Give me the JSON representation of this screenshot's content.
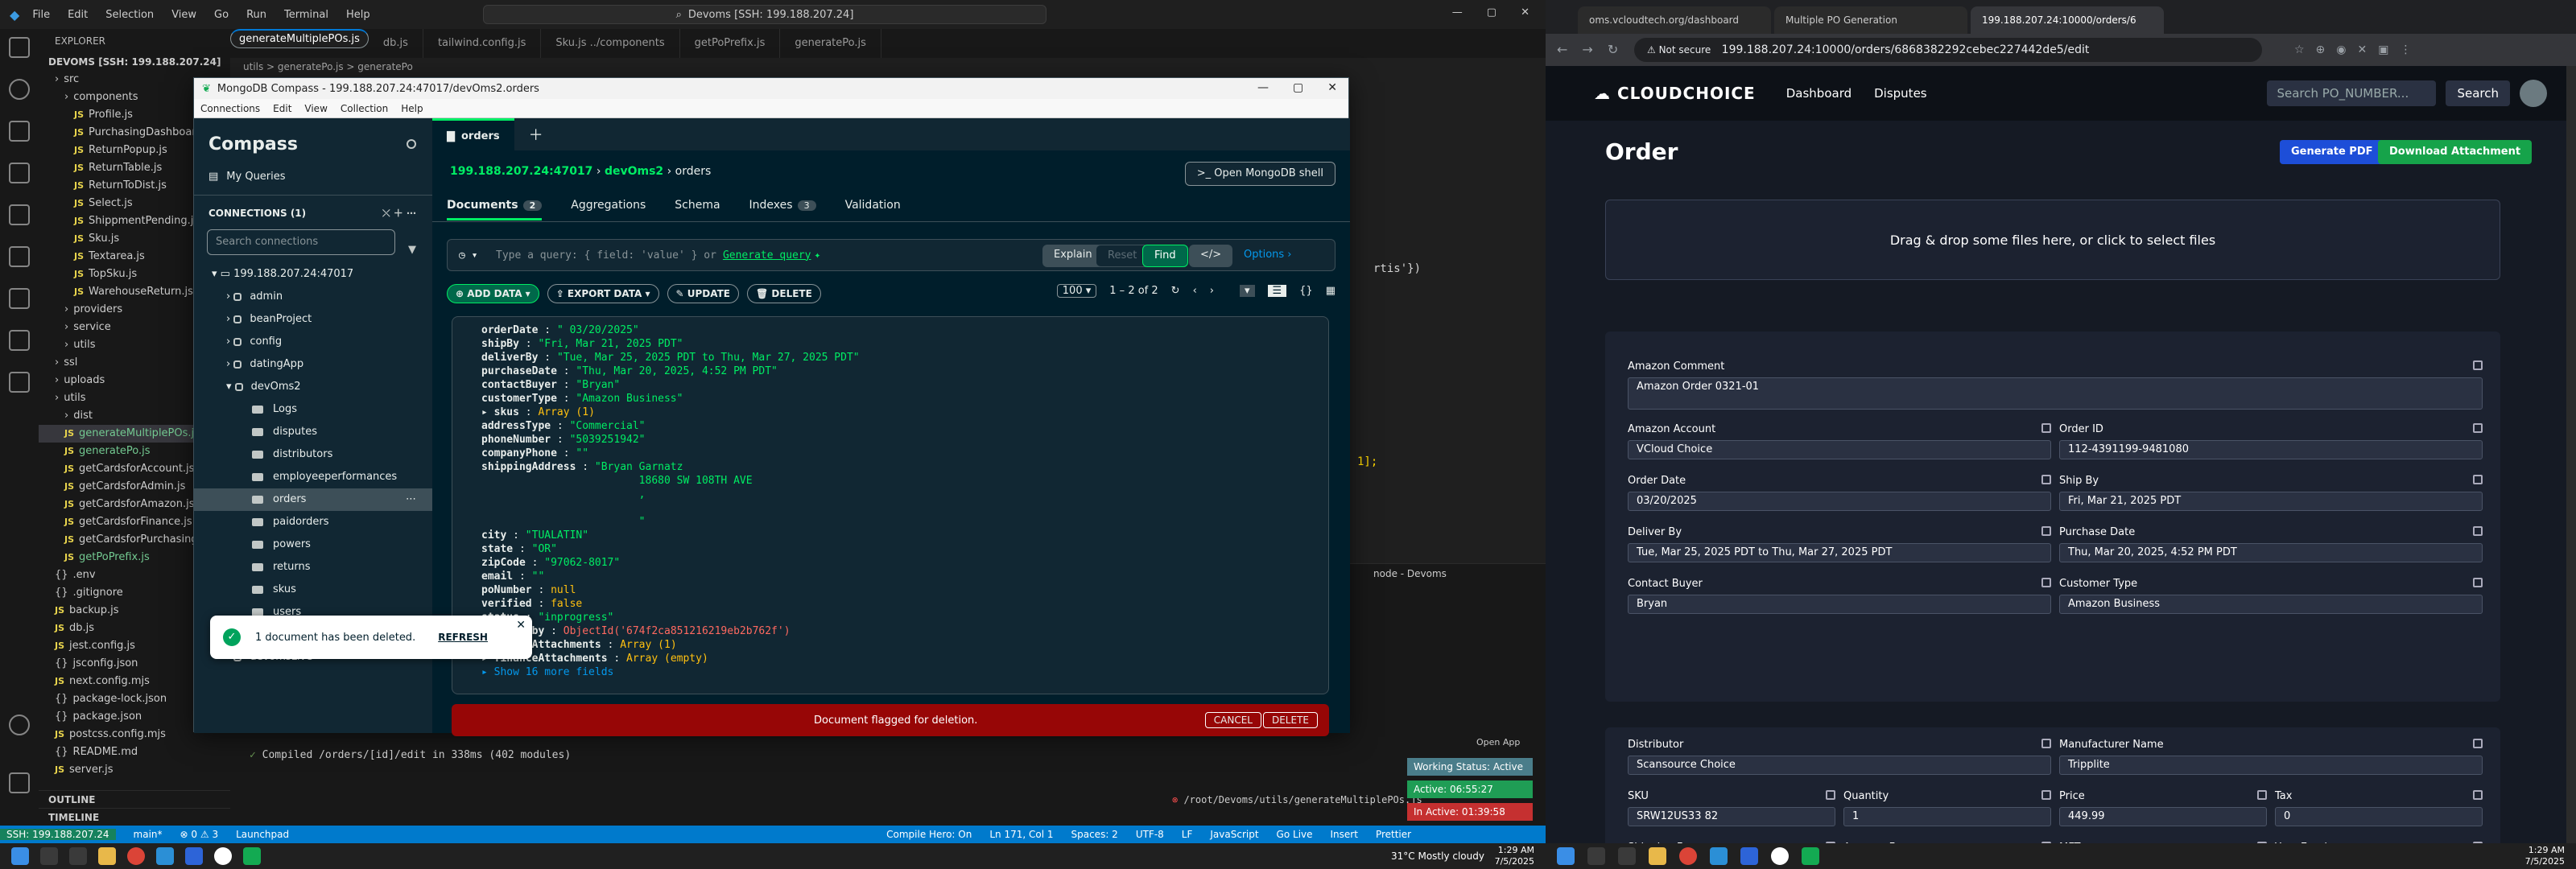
{
  "vscode": {
    "menu": [
      "File",
      "Edit",
      "Selection",
      "View",
      "Go",
      "Run",
      "Terminal",
      "Help"
    ],
    "command_center": "Devoms [SSH: 199.188.207.24]",
    "explorer_title": "EXPLORER",
    "root_label": "DEVOMS [SSH: 199.188.207.24]",
    "tree": [
      {
        "name": "src",
        "type": "folder"
      },
      {
        "name": "components",
        "type": "folder"
      },
      {
        "name": "Profile.js",
        "type": "js"
      },
      {
        "name": "PurchasingDashboard.js",
        "type": "js"
      },
      {
        "name": "ReturnPopup.js",
        "type": "js"
      },
      {
        "name": "ReturnTable.js",
        "type": "js"
      },
      {
        "name": "ReturnToDist.js",
        "type": "js"
      },
      {
        "name": "Select.js",
        "type": "js"
      },
      {
        "name": "ShippmentPending.js",
        "type": "js"
      },
      {
        "name": "Sku.js",
        "type": "js"
      },
      {
        "name": "Textarea.js",
        "type": "js"
      },
      {
        "name": "TopSku.js",
        "type": "js"
      },
      {
        "name": "WarehouseReturn.js",
        "type": "js"
      },
      {
        "name": "providers",
        "type": "folder"
      },
      {
        "name": "service",
        "type": "folder"
      },
      {
        "name": "utils",
        "type": "folder"
      },
      {
        "name": "ssl",
        "type": "folder"
      },
      {
        "name": "uploads",
        "type": "folder"
      },
      {
        "name": "utils",
        "type": "folder"
      },
      {
        "name": "dist",
        "type": "folder"
      },
      {
        "name": "generateMultiplePOs.js",
        "type": "js"
      },
      {
        "name": "generatePo.js",
        "type": "js"
      },
      {
        "name": "getCardsforAccount.js",
        "type": "js"
      },
      {
        "name": "getCardsforAdmin.js",
        "type": "js"
      },
      {
        "name": "getCardsforAmazon.js",
        "type": "js"
      },
      {
        "name": "getCardsforFinance.js",
        "type": "js"
      },
      {
        "name": "getCardsforPurchasing.js",
        "type": "js"
      },
      {
        "name": "getPoPrefix.js",
        "type": "js"
      },
      {
        "name": ".env",
        "type": "file"
      },
      {
        "name": ".gitignore",
        "type": "file"
      },
      {
        "name": "backup.js",
        "type": "js"
      },
      {
        "name": "db.js",
        "type": "js"
      },
      {
        "name": "jest.config.js",
        "type": "js"
      },
      {
        "name": "jsconfig.json",
        "type": "file"
      },
      {
        "name": "next.config.mjs",
        "type": "js"
      },
      {
        "name": "package-lock.json",
        "type": "file"
      },
      {
        "name": "package.json",
        "type": "file"
      },
      {
        "name": "postcss.config.mjs",
        "type": "js"
      },
      {
        "name": "README.md",
        "type": "file"
      },
      {
        "name": "server.js",
        "type": "js"
      }
    ],
    "outline": "OUTLINE",
    "timeline": "TIMELINE",
    "tabs": [
      "generateMultiplePOs.js",
      "db.js",
      "tailwind.config.js",
      "Sku.js ../components",
      "getPoPrefix.js",
      "generatePo.js"
    ],
    "breadcrumb": "utils > generatePo.js > generatePo",
    "code_snippet": "rtis'})",
    "code_snippet2": "1];",
    "terminal_line1": "Compiled /orders/[id]/edit in 338ms (402 modules)",
    "terminal_path": "/root/Devoms/utils/generateMultiplePOs.js",
    "terminal_title": "node - Devoms",
    "popups": [
      "Working Status: Active",
      "Active: 06:55:27",
      "In Active: 01:39:58"
    ],
    "open_app": "Open App",
    "status": {
      "remote": "SSH: 199.188.207.24",
      "branch": "main*",
      "errors": "0",
      "warnings": "3",
      "launchpad": "Launchpad",
      "compile": "Compile Hero: On",
      "position": "Ln 171, Col 1",
      "spaces": "Spaces: 2",
      "encoding": "UTF-8",
      "eol": "LF",
      "lang": "JavaScript",
      "golive": "Go Live",
      "insert": "Insert",
      "prettier": "Prettier"
    },
    "taskbar_weather": "31°C  Mostly cloudy",
    "taskbar_time": "1:29 AM",
    "taskbar_date": "7/5/2025"
  },
  "compass": {
    "title": "MongoDB Compass - 199.188.207.24:47017/devOms2.orders",
    "menu": [
      "Connections",
      "Edit",
      "View",
      "Collection",
      "Help"
    ],
    "brand": "Compass",
    "my_queries": "My Queries",
    "connections_label": "CONNECTIONS (1)",
    "search_placeholder": "Search connections",
    "host": "199.188.207.24:47017",
    "dbs": [
      "admin",
      "beanProject",
      "config",
      "datingApp",
      "devOms2"
    ],
    "collections": [
      "Logs",
      "disputes",
      "distributors",
      "employeeperformances",
      "orders",
      "paidorders",
      "powers",
      "returns",
      "skus",
      "users"
    ],
    "dbs_after": [
      "devoms",
      "devomsLive"
    ],
    "tab_label": "orders",
    "breadcrumb": [
      "199.188.207.24:47017",
      "devOms2",
      "orders"
    ],
    "shell_button": "Open MongoDB shell",
    "subtabs": [
      {
        "label": "Documents",
        "count": "2"
      },
      {
        "label": "Aggregations"
      },
      {
        "label": "Schema"
      },
      {
        "label": "Indexes",
        "count": "3"
      },
      {
        "label": "Validation"
      }
    ],
    "query_placeholder": "Type a query: { field: 'value' } or",
    "generate_query": "Generate query",
    "explain": "Explain",
    "reset": "Reset",
    "find": "Find",
    "options": "Options",
    "add_data": "ADD DATA",
    "export_data": "EXPORT DATA",
    "update": "UPDATE",
    "delete": "DELETE",
    "page_size": "100",
    "range": "1 – 2 of 2",
    "doc_lines": [
      {
        "k": "orderDate",
        "v": "\" 03/20/2025\"",
        "t": "s"
      },
      {
        "k": "shipBy",
        "v": "\"Fri, Mar 21, 2025 PDT\"",
        "t": "s"
      },
      {
        "k": "deliverBy",
        "v": "\"Tue, Mar 25, 2025 PDT to Thu, Mar 27, 2025 PDT\"",
        "t": "s"
      },
      {
        "k": "purchaseDate",
        "v": "\"Thu, Mar 20, 2025, 4:52 PM PDT\"",
        "t": "s"
      },
      {
        "k": "contactBuyer",
        "v": "\"Bryan\"",
        "t": "s"
      },
      {
        "k": "customerType",
        "v": "\"Amazon Business\"",
        "t": "s"
      },
      {
        "k": "▸ skus",
        "v": "Array (1)",
        "t": "p"
      },
      {
        "k": "addressType",
        "v": "\"Commercial\"",
        "t": "s"
      },
      {
        "k": "phoneNumber",
        "v": "\"5039251942\"",
        "t": "s"
      },
      {
        "k": "companyPhone",
        "v": "\"\"",
        "t": "s"
      },
      {
        "k": "shippingAddress",
        "v": "\"Bryan Garnatz",
        "t": "s"
      },
      {
        "k": "",
        "v": "        18680 SW 108TH AVE",
        "t": "s"
      },
      {
        "k": "",
        "v": "        ,",
        "t": "s"
      },
      {
        "k": "",
        "v": "",
        "t": "s"
      },
      {
        "k": "",
        "v": "        \"",
        "t": "s"
      },
      {
        "k": "city",
        "v": "\"TUALATIN\"",
        "t": "s"
      },
      {
        "k": "state",
        "v": "\"OR\"",
        "t": "s"
      },
      {
        "k": "zipCode",
        "v": "\"97062-8017\"",
        "t": "s"
      },
      {
        "k": "email",
        "v": "\"\"",
        "t": "s"
      },
      {
        "k": "poNumber",
        "v": "null",
        "t": "p"
      },
      {
        "k": "verified",
        "v": "false",
        "t": "p"
      },
      {
        "k": "status",
        "v": "\"inprogress\"",
        "t": "s"
      },
      {
        "k": "created_by",
        "v": "ObjectId('674f2ca851216219eb2b762f')",
        "t": "o"
      },
      {
        "k": "▸ amazonAttachments",
        "v": "Array (1)",
        "t": "p"
      },
      {
        "k": "▸ financeAttachments",
        "v": "Array (empty)",
        "t": "p"
      }
    ],
    "show_more": "▸ Show 16 more fields",
    "delete_bar_text": "Document flagged for deletion.",
    "cancel": "CANCEL",
    "delete_btn": "DELETE",
    "toast_text": "1 document has been deleted.",
    "toast_refresh": "REFRESH"
  },
  "chrome": {
    "tabs": [
      "oms.vcloudtech.org/dashboard",
      "Multiple PO Generation",
      "199.188.207.24:10000/orders/6"
    ],
    "not_secure": "Not secure",
    "url": "199.188.207.24:10000/orders/6868382292cebec227442de5/edit",
    "logo": "CLOUDCHOICE",
    "nav": [
      "Dashboard",
      "Disputes"
    ],
    "search_placeholder": "Search PO_NUMBER...",
    "search_btn": "Search",
    "heading": "Order",
    "btn_pdf": "Generate PDF",
    "btn_download": "Download Attachment",
    "dropzone": "Drag & drop some files here, or click to select files",
    "fields": {
      "amazon_comment": {
        "label": "Amazon Comment",
        "value": "Amazon Order 0321-01"
      },
      "amazon_account": {
        "label": "Amazon Account",
        "value": "VCloud Choice"
      },
      "order_id": {
        "label": "Order ID",
        "value": "112-4391199-9481080"
      },
      "order_date": {
        "label": "Order Date",
        "value": "03/20/2025"
      },
      "ship_by": {
        "label": "Ship By",
        "value": "Fri, Mar 21, 2025 PDT"
      },
      "deliver_by": {
        "label": "Deliver By",
        "value": "Tue, Mar 25, 2025 PDT to Thu, Mar 27, 2025 PDT"
      },
      "purchase_date": {
        "label": "Purchase Date",
        "value": "Thu, Mar 20, 2025, 4:52 PM PDT"
      },
      "contact_buyer": {
        "label": "Contact Buyer",
        "value": "Bryan"
      },
      "customer_type": {
        "label": "Customer Type",
        "value": "Amazon Business"
      },
      "distributor": {
        "label": "Distributor",
        "value": "Scansource Choice"
      },
      "manufacturer": {
        "label": "Manufacturer Name",
        "value": "Tripplite"
      },
      "sku": {
        "label": "SKU",
        "value": "SRW12US33 82"
      },
      "quantity": {
        "label": "Quantity",
        "value": "1"
      },
      "price": {
        "label": "Price",
        "value": "449.99"
      },
      "tax": {
        "label": "Tax",
        "value": "0"
      },
      "shipping_fee": {
        "label": "Shipping Fee"
      },
      "amazon_fee": {
        "label": "Amazon Fee"
      },
      "mft": {
        "label": "MFT"
      },
      "your_earning": {
        "label": "Your Earning"
      }
    },
    "taskbar_time": "1:29 AM",
    "taskbar_date": "7/5/2025"
  }
}
